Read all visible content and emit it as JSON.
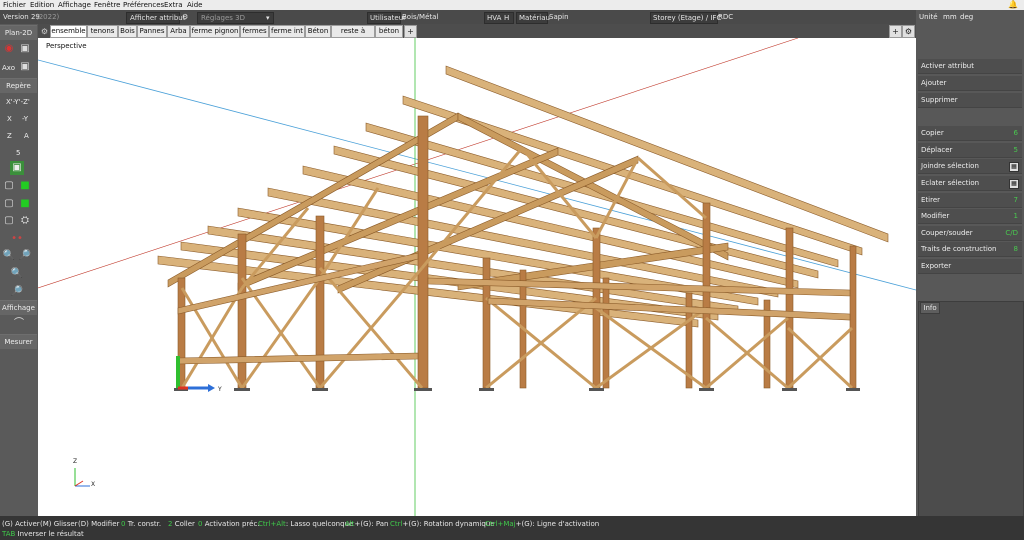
{
  "menu": [
    "Fichier",
    "Edition",
    "Affichage",
    "Fenêtre",
    "Préférences",
    "Extra",
    "Aide"
  ],
  "toolbar": {
    "version": "Version 29",
    "version_year": "(2022)",
    "afficher_attribut": "Afficher attribut",
    "reglages_3d": "Réglages 3D",
    "utilisateur_label": "Utilisateur",
    "utilisateur_value": "Bois/Métal",
    "hva": "HVA",
    "h": "H",
    "materiau_label": "Matériau",
    "materiau_value": "Sapin",
    "storey": "Storey (Etage) / IFC",
    "rdc": "RDC",
    "unite_label": "Unité",
    "unite_length": "mm",
    "unite_angle": "deg"
  },
  "tabs": [
    "ensemble",
    "tenons",
    "Bois",
    "Pannes",
    "Arba",
    "ferme pignon",
    "fermes",
    "ferme int",
    "Béton",
    "reste à faire",
    "béton"
  ],
  "tab_add": "+",
  "tab_right": [
    "+",
    "o"
  ],
  "left": {
    "plan2d": "Plan-2D",
    "axo": "Axo",
    "repere": "Repère",
    "xyz": "X'-Y'-Z'",
    "x": "X",
    "neg_y": "-Y",
    "z": "Z",
    "a": "A",
    "five": "5",
    "affichage": "Affichage",
    "mesurer": "Mesurer"
  },
  "viewport": {
    "label": "Perspective",
    "axis_y": "Y",
    "mini_z": "Z",
    "mini_x": "X"
  },
  "right": {
    "buttons": [
      {
        "label": "Activer attribut",
        "key": ""
      },
      {
        "label": "Ajouter",
        "key": ""
      },
      {
        "label": "Supprimer",
        "key": ""
      },
      {
        "label": "Copier",
        "key": "6"
      },
      {
        "label": "Déplacer",
        "key": "5"
      },
      {
        "label": "Joindre sélection",
        "key": ""
      },
      {
        "label": "Eclater sélection",
        "key": ""
      },
      {
        "label": "Etirer",
        "key": "7"
      },
      {
        "label": "Modifier",
        "key": "1"
      },
      {
        "label": "Couper/souder",
        "key": "C/D"
      },
      {
        "label": "Traits de construction",
        "key": "8"
      },
      {
        "label": "Exporter",
        "key": ""
      }
    ],
    "info": "Info"
  },
  "status": {
    "l1": [
      {
        "k": "(G)",
        "t": " Activer"
      },
      {
        "k": "(M)",
        "t": " Glisser"
      },
      {
        "k": "(D)",
        "t": " Modifier"
      },
      {
        "k": "0",
        "t": " Tr. constr."
      },
      {
        "k": "2",
        "t": " Coller"
      },
      {
        "k": "0",
        "t": " Activation préc."
      },
      {
        "k": "Ctrl+Alt",
        "t": ": Lasso quelconque"
      },
      {
        "k": "Alt",
        "t": "+(G): Pan"
      },
      {
        "k": "Ctrl",
        "t": "+(G): Rotation dynamique"
      },
      {
        "k": "Ctrl+Maj",
        "t": "+(G): Ligne d'activation"
      }
    ],
    "l2_key": "TAB",
    "l2_text": " Inverser le résultat"
  }
}
